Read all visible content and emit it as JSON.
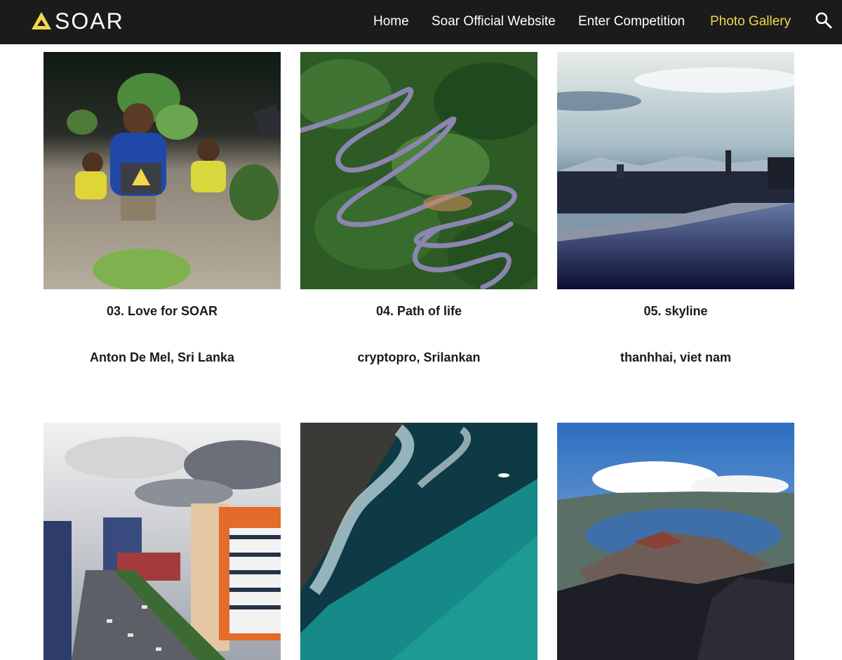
{
  "brand": {
    "name": "SOAR",
    "accent": "#f2d74c",
    "nav_bg": "#1b1b1b"
  },
  "nav": {
    "home": "Home",
    "official": "Soar Official Website",
    "competition": "Enter Competition",
    "gallery": "Photo Gallery",
    "search_icon": "search-icon"
  },
  "gallery": {
    "items": [
      {
        "title": "03. Love for SOAR",
        "author": "Anton De Mel, Sri Lanka"
      },
      {
        "title": "04. Path of life",
        "author": "cryptopro, Srilankan"
      },
      {
        "title": "05. skyline",
        "author": "thanhhai, viet nam"
      },
      {
        "title": "",
        "author": ""
      },
      {
        "title": "",
        "author": ""
      },
      {
        "title": "",
        "author": ""
      }
    ]
  }
}
